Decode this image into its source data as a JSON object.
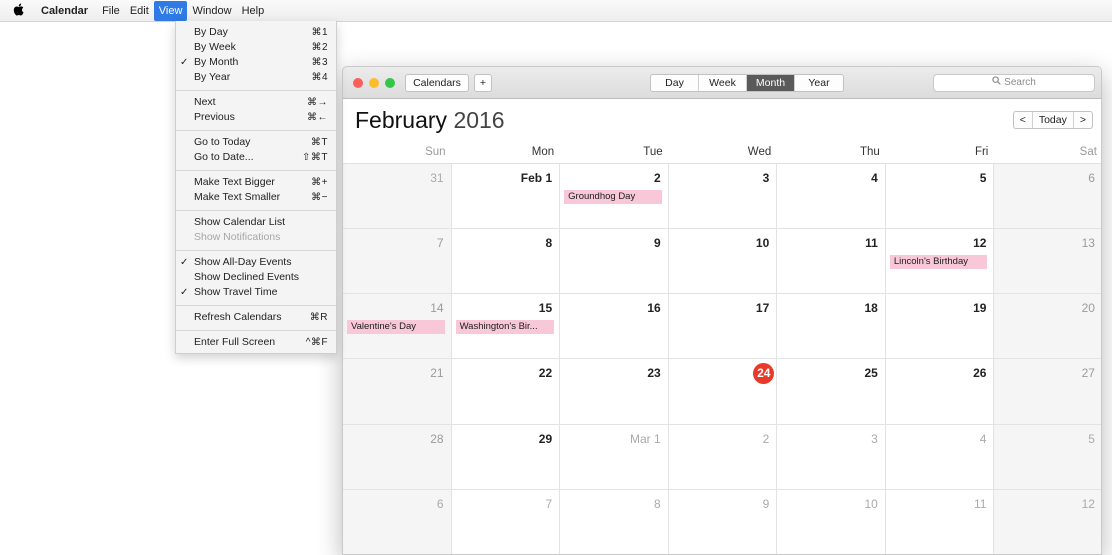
{
  "menubar": {
    "apple_icon": "apple-icon",
    "app": "Calendar",
    "items": [
      "File",
      "Edit",
      "View",
      "Window",
      "Help"
    ],
    "active": "View"
  },
  "view_menu": {
    "rows": [
      {
        "label": "By Day",
        "shortcut": "⌘1",
        "checked": false,
        "disabled": false
      },
      {
        "label": "By Week",
        "shortcut": "⌘2",
        "checked": false,
        "disabled": false
      },
      {
        "label": "By Month",
        "shortcut": "⌘3",
        "checked": true,
        "disabled": false
      },
      {
        "label": "By Year",
        "shortcut": "⌘4",
        "checked": false,
        "disabled": false
      },
      {
        "sep": true
      },
      {
        "label": "Next",
        "shortcut": "⌘→",
        "checked": false,
        "disabled": false
      },
      {
        "label": "Previous",
        "shortcut": "⌘←",
        "checked": false,
        "disabled": false
      },
      {
        "sep": true
      },
      {
        "label": "Go to Today",
        "shortcut": "⌘T",
        "checked": false,
        "disabled": false
      },
      {
        "label": "Go to Date...",
        "shortcut": "⇧⌘T",
        "checked": false,
        "disabled": false
      },
      {
        "sep": true
      },
      {
        "label": "Make Text Bigger",
        "shortcut": "⌘+",
        "checked": false,
        "disabled": false
      },
      {
        "label": "Make Text Smaller",
        "shortcut": "⌘−",
        "checked": false,
        "disabled": false
      },
      {
        "sep": true
      },
      {
        "label": "Show Calendar List",
        "shortcut": "",
        "checked": false,
        "disabled": false
      },
      {
        "label": "Show Notifications",
        "shortcut": "",
        "checked": false,
        "disabled": true
      },
      {
        "sep": true
      },
      {
        "label": "Show All-Day Events",
        "shortcut": "",
        "checked": true,
        "disabled": false
      },
      {
        "label": "Show Declined Events",
        "shortcut": "",
        "checked": false,
        "disabled": false
      },
      {
        "label": "Show Travel Time",
        "shortcut": "",
        "checked": true,
        "disabled": false
      },
      {
        "sep": true
      },
      {
        "label": "Refresh Calendars",
        "shortcut": "⌘R",
        "checked": false,
        "disabled": false
      },
      {
        "sep": true
      },
      {
        "label": "Enter Full Screen",
        "shortcut": "^⌘F",
        "checked": false,
        "disabled": false
      }
    ]
  },
  "window": {
    "traffic_colors": [
      "#fc5f57",
      "#fdbc2e",
      "#33c748"
    ],
    "calendars_label": "Calendars",
    "add_label": "+",
    "view_tabs": [
      "Day",
      "Week",
      "Month",
      "Year"
    ],
    "selected_view": "Month",
    "search_placeholder": "Search",
    "month": "February",
    "year": "2016",
    "nav": {
      "prev": "<",
      "today": "Today",
      "next": ">"
    }
  },
  "calendar": {
    "weekdays": [
      "Sun",
      "Mon",
      "Tue",
      "Wed",
      "Thu",
      "Fri",
      "Sat"
    ],
    "accent_today": "#e8392b",
    "event_color": "#f8c7d8",
    "weeks": [
      [
        {
          "d": "31",
          "out": true
        },
        {
          "d": "Feb 1"
        },
        {
          "d": "2",
          "event": "Groundhog Day"
        },
        {
          "d": "3"
        },
        {
          "d": "4"
        },
        {
          "d": "5"
        },
        {
          "d": "6"
        }
      ],
      [
        {
          "d": "7"
        },
        {
          "d": "8"
        },
        {
          "d": "9"
        },
        {
          "d": "10"
        },
        {
          "d": "11"
        },
        {
          "d": "12",
          "event": "Lincoln's Birthday"
        },
        {
          "d": "13"
        }
      ],
      [
        {
          "d": "14",
          "event": "Valentine's Day"
        },
        {
          "d": "15",
          "event": "Washington's Bir..."
        },
        {
          "d": "16"
        },
        {
          "d": "17"
        },
        {
          "d": "18"
        },
        {
          "d": "19"
        },
        {
          "d": "20"
        }
      ],
      [
        {
          "d": "21"
        },
        {
          "d": "22"
        },
        {
          "d": "23"
        },
        {
          "d": "24",
          "today": true
        },
        {
          "d": "25"
        },
        {
          "d": "26"
        },
        {
          "d": "27"
        }
      ],
      [
        {
          "d": "28"
        },
        {
          "d": "29"
        },
        {
          "d": "Mar 1",
          "out": true
        },
        {
          "d": "2",
          "out": true
        },
        {
          "d": "3",
          "out": true
        },
        {
          "d": "4",
          "out": true
        },
        {
          "d": "5",
          "out": true
        }
      ],
      [
        {
          "d": "6",
          "out": true
        },
        {
          "d": "7",
          "out": true
        },
        {
          "d": "8",
          "out": true
        },
        {
          "d": "9",
          "out": true
        },
        {
          "d": "10",
          "out": true
        },
        {
          "d": "11",
          "out": true
        },
        {
          "d": "12",
          "out": true
        }
      ]
    ]
  }
}
